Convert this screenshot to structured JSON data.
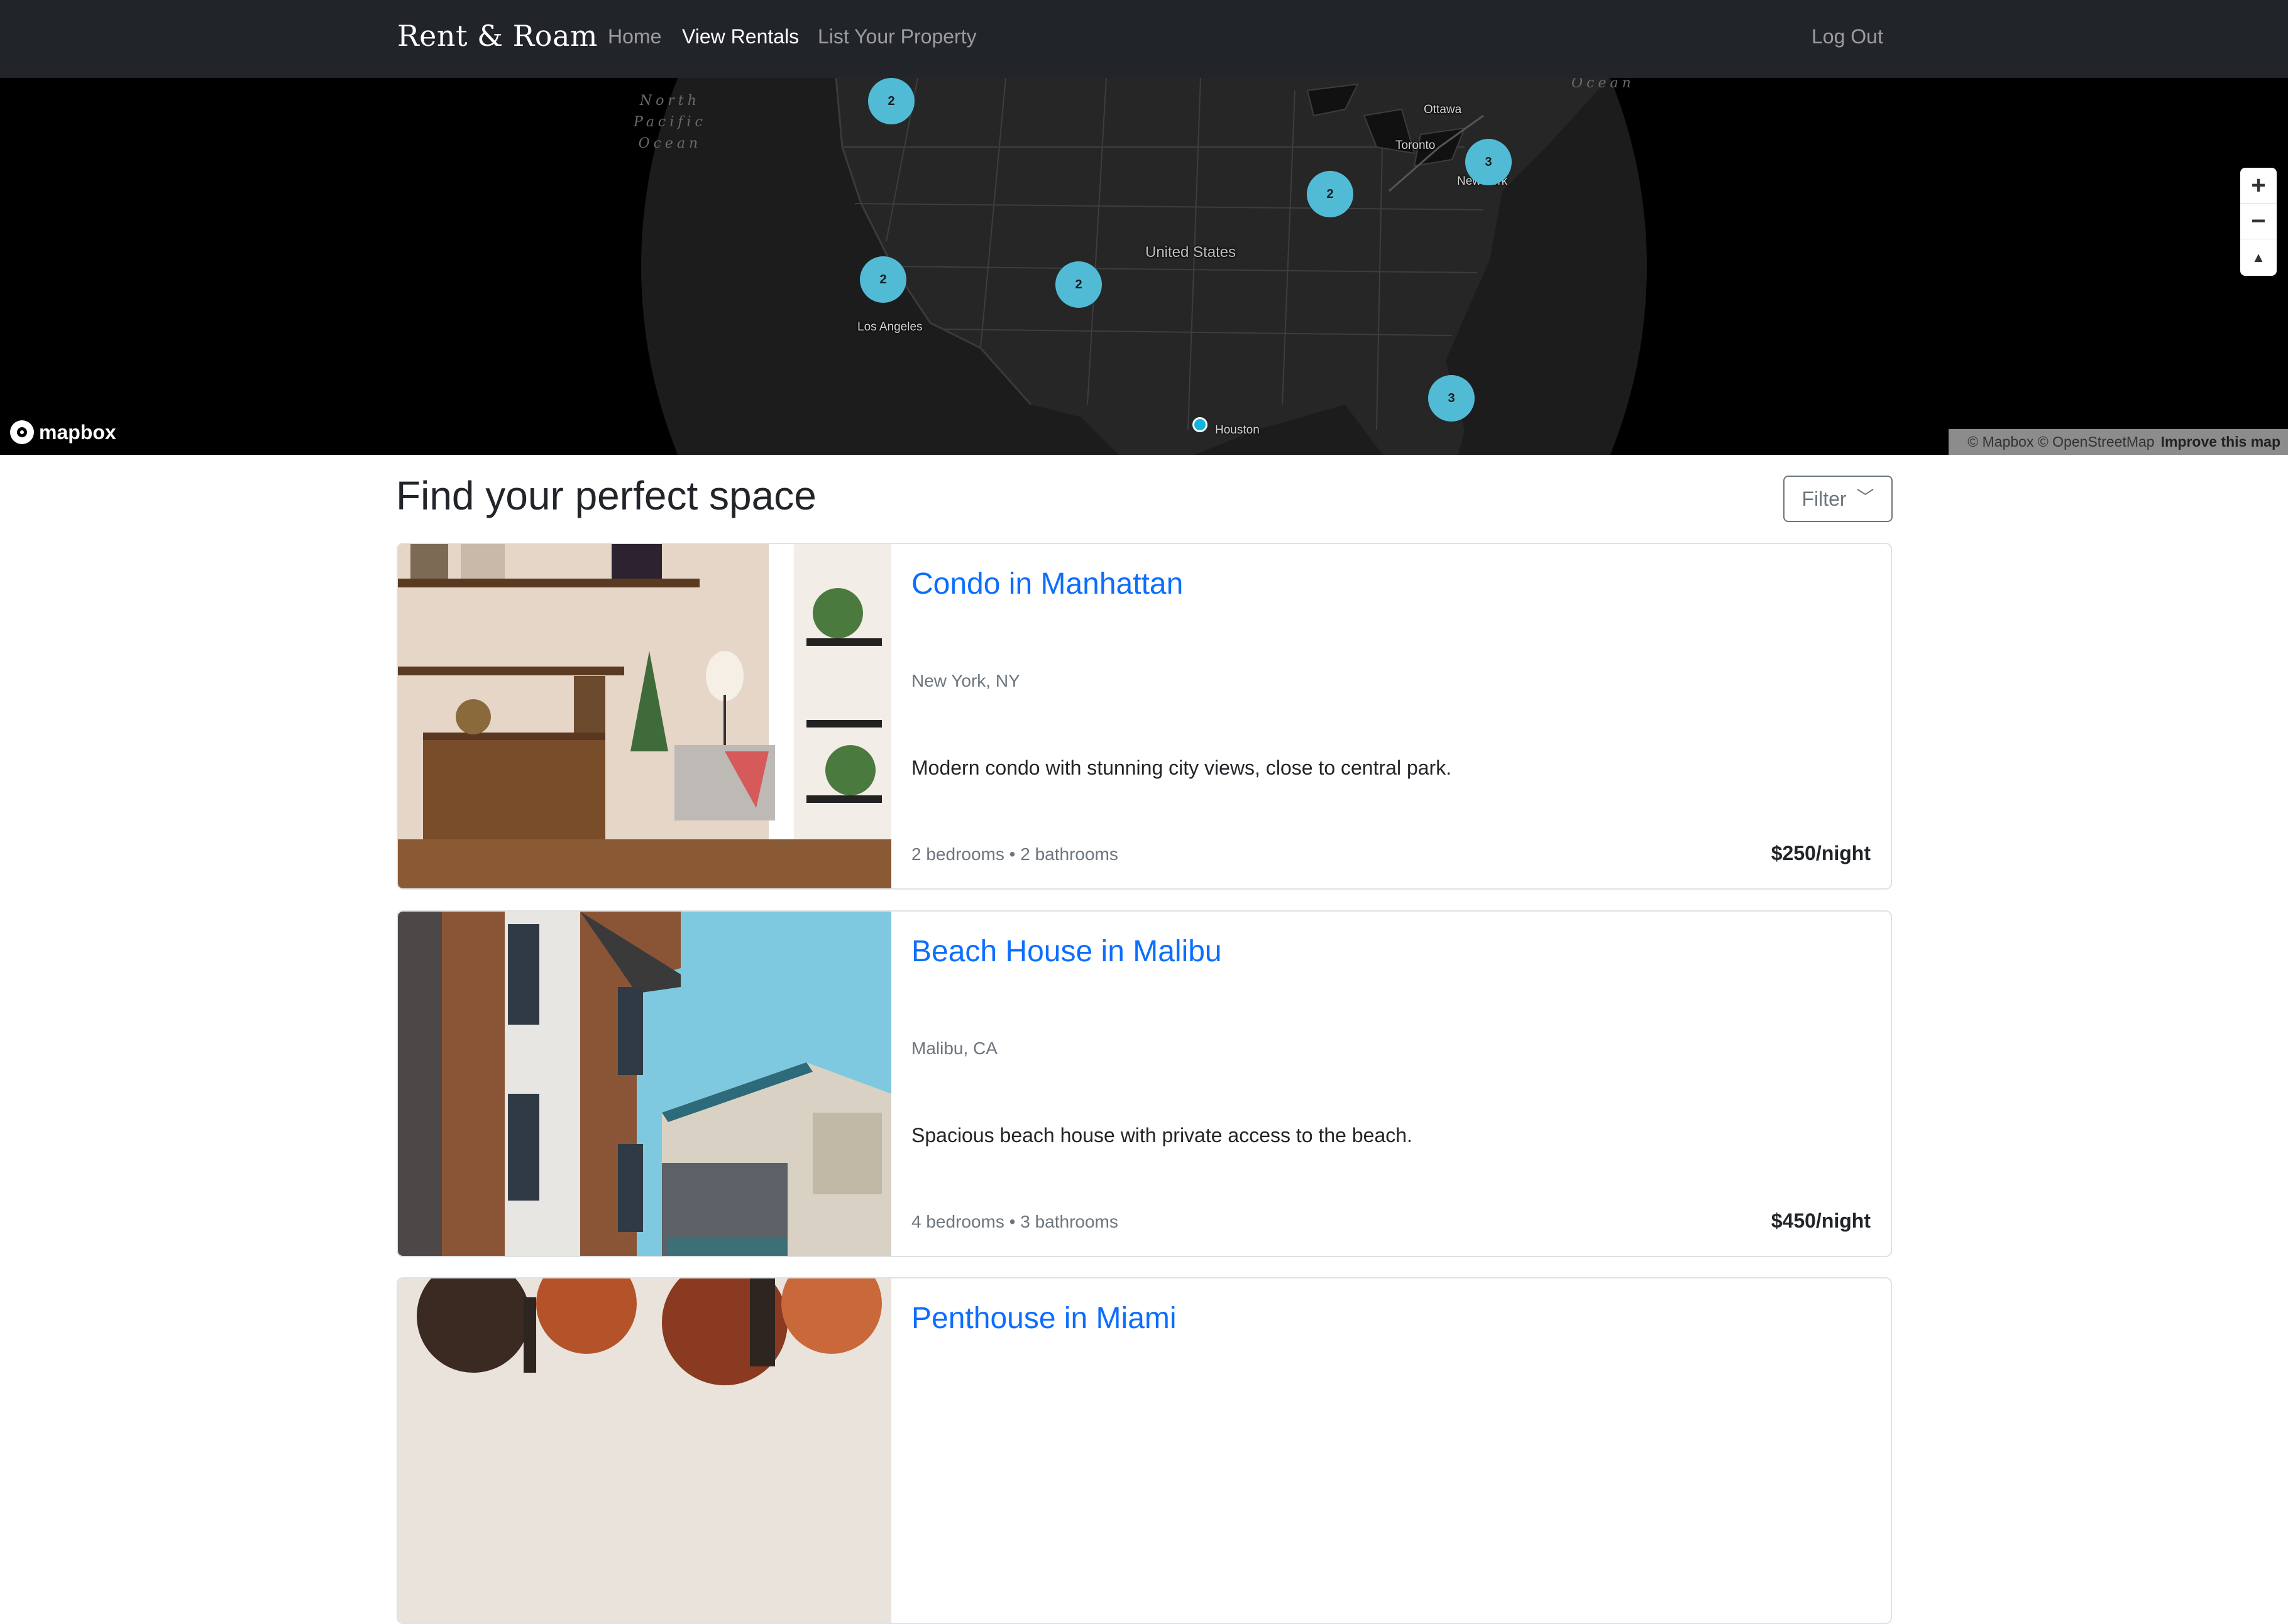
{
  "navbar": {
    "brand": "Rent & Roam",
    "links": [
      "Home",
      "View Rentals",
      "List Your Property"
    ],
    "active_link": "View Rentals",
    "logout": "Log Out"
  },
  "map": {
    "ocean_label_lines": [
      "North",
      "Pacific",
      "Ocean"
    ],
    "ocean_label_east": "Ocean",
    "country_label": "United States",
    "city_labels": [
      "Ottawa",
      "Toronto",
      "New York",
      "Los Angeles",
      "Houston"
    ],
    "clusters": [
      {
        "count": "2",
        "location": "Pacific Northwest"
      },
      {
        "count": "2",
        "location": "Chicago"
      },
      {
        "count": "3",
        "location": "New York"
      },
      {
        "count": "2",
        "location": "Los Angeles"
      },
      {
        "count": "2",
        "location": "Colorado"
      },
      {
        "count": "3",
        "location": "Miami"
      }
    ],
    "single_points": [
      "Houston"
    ],
    "zoom_in": "+",
    "zoom_out": "−",
    "compass": "▲",
    "logo_text": "mapbox",
    "attribution": "© Mapbox © OpenStreetMap",
    "improve": "Improve this map",
    "colors": {
      "cluster": "#51bbd6",
      "point": "#11b4da",
      "land": "#1c1c1c"
    }
  },
  "main": {
    "heading": "Find your perfect space",
    "filter_label": "Filter",
    "filter_icon": "chevron-down-icon"
  },
  "listings": [
    {
      "title": "Condo in Manhattan",
      "location": "New York, NY",
      "description": "Modern condo with stunning city views, close to central park.",
      "meta": "2 bedrooms • 2 bathrooms",
      "price": "$250/night"
    },
    {
      "title": "Beach House in Malibu",
      "location": "Malibu, CA",
      "description": "Spacious beach house with private access to the beach.",
      "meta": "4 bedrooms • 3 bathrooms",
      "price": "$450/night"
    },
    {
      "title": "Penthouse in Miami"
    }
  ]
}
